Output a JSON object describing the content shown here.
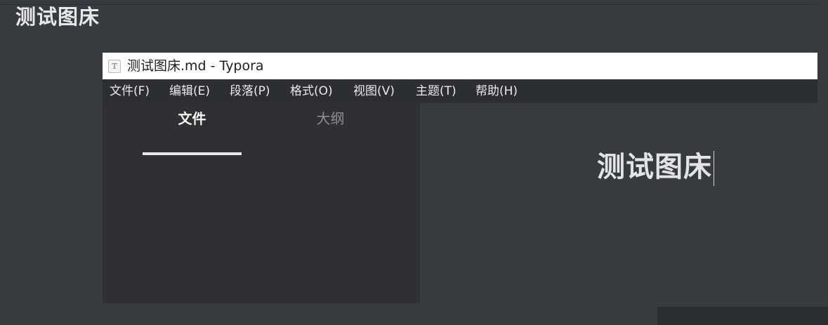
{
  "page": {
    "heading": "测试图床"
  },
  "window": {
    "icon_glyph": "T",
    "title": "测试图床.md - Typora"
  },
  "menu": {
    "items": [
      {
        "label": "文件(F)"
      },
      {
        "label": "编辑(E)"
      },
      {
        "label": "段落(P)"
      },
      {
        "label": "格式(O)"
      },
      {
        "label": "视图(V)"
      },
      {
        "label": "主题(T)"
      },
      {
        "label": "帮助(H)"
      }
    ]
  },
  "sidebar": {
    "tabs": [
      {
        "label": "文件",
        "active": true
      },
      {
        "label": "大纲",
        "active": false
      }
    ]
  },
  "editor": {
    "heading": "测试图床"
  },
  "icons": {
    "app": "typora-icon"
  },
  "colors": {
    "background": "#363b40",
    "sidebar": "#2e3033",
    "menubar": "#2b2e33",
    "titlebar": "#ffffff"
  }
}
